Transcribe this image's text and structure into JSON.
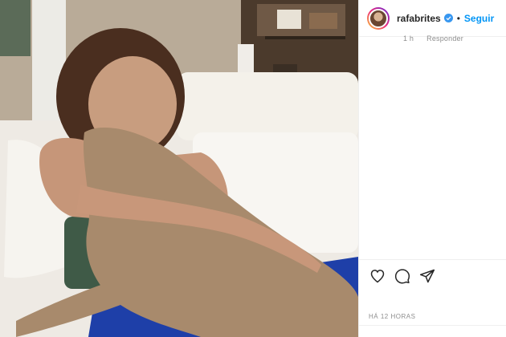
{
  "post": {
    "username": "rafabrites",
    "separator": "•",
    "follow_label": "Seguir",
    "comment_meta": {
      "likes": "1 h",
      "reply_label": "Responder"
    },
    "timestamp": "HÁ 12 HORAS"
  },
  "icons": {
    "verified": "verified-badge-icon",
    "like": "heart-icon",
    "comment": "comment-icon",
    "share": "share-icon"
  },
  "colors": {
    "accent": "#0095f6",
    "text": "#262626",
    "muted": "#8e8e8e"
  }
}
